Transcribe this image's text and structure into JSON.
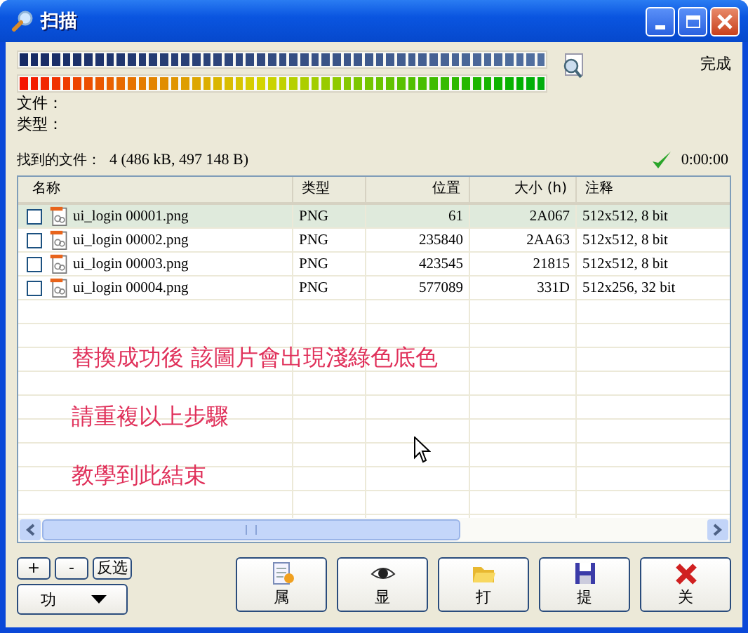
{
  "window": {
    "title": "扫描"
  },
  "progress": [
    {
      "kind": "blue",
      "level": 1
    },
    {
      "kind": "spectrum",
      "level": 1
    }
  ],
  "status": "完成",
  "fields": [
    {
      "label": "文件："
    },
    {
      "label": "类型："
    }
  ],
  "found": {
    "label": "找到的文件：",
    "value": "4 (486 kB, 497 148 B)"
  },
  "elapsed": "0:00:00",
  "table": {
    "columns": [
      {
        "label": "名称"
      },
      {
        "label": "类型"
      },
      {
        "label": "位置"
      },
      {
        "label": "大小 (h)"
      },
      {
        "label": "注释"
      }
    ],
    "rows": [
      {
        "selected": true,
        "checked": false,
        "cells": [
          "ui_login 00001.png",
          "PNG",
          "61",
          "2A067",
          "512x512, 8 bit"
        ]
      },
      {
        "selected": false,
        "checked": false,
        "cells": [
          "ui_login 00002.png",
          "PNG",
          "235840",
          "2AA63",
          "512x512, 8 bit"
        ]
      },
      {
        "selected": false,
        "checked": false,
        "cells": [
          "ui_login 00003.png",
          "PNG",
          "423545",
          "21815",
          "512x512, 8 bit"
        ]
      },
      {
        "selected": false,
        "checked": false,
        "cells": [
          "ui_login 00004.png",
          "PNG",
          "577089",
          "331D",
          "512x256, 32 bit"
        ]
      }
    ],
    "annotations": [
      "替換成功後 該圖片會出現淺綠色底色",
      "請重複以上步驟",
      "教學到此結束"
    ]
  },
  "select_buttons": [
    "+",
    "-",
    "反选"
  ],
  "function_menu": {
    "label": "功"
  },
  "actions": [
    {
      "kind": "properties",
      "label": "属"
    },
    {
      "kind": "view",
      "label": "显"
    },
    {
      "kind": "open",
      "label": "打"
    },
    {
      "kind": "extract",
      "label": "提"
    },
    {
      "kind": "close",
      "label": "关"
    }
  ]
}
